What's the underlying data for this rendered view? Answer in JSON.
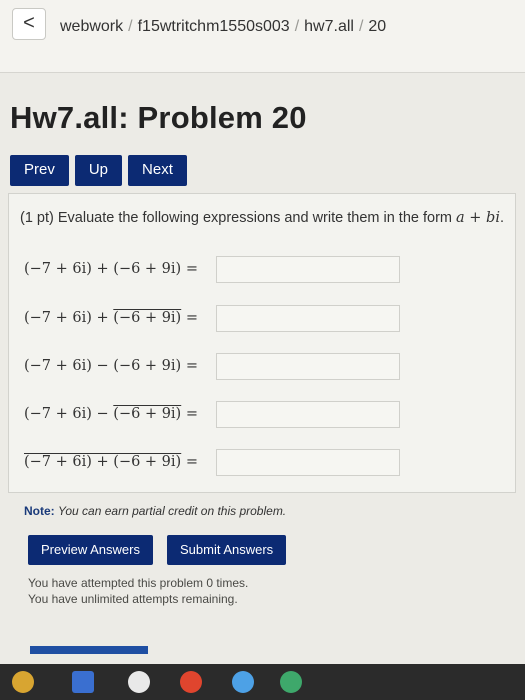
{
  "header": {
    "back_glyph": "<",
    "breadcrumb": [
      "webwork",
      "f15wtritchm1550s003",
      "hw7.all",
      "20"
    ],
    "separator": "/"
  },
  "page_title": "Hw7.all: Problem 20",
  "nav": {
    "prev": "Prev",
    "up": "Up",
    "next": "Next"
  },
  "problem": {
    "points": "(1 pt)",
    "prompt": "Evaluate the following expressions and write them in the form",
    "form": "a + bi",
    "rows": [
      {
        "left": "(−7 + 6i) + (−6 + 9i) =",
        "answer": ""
      },
      {
        "left_a": "(−7 + 6i) + ",
        "left_bar": "(−6 + 9i)",
        "left_b": " =",
        "answer": ""
      },
      {
        "left": "(−7 + 6i) − (−6 + 9i) =",
        "answer": ""
      },
      {
        "left_a": "(−7 + 6i) − ",
        "left_bar": "(−6 + 9i)",
        "left_b": " =",
        "answer": ""
      },
      {
        "left_bar": "(−7 + 6i) + (−6 + 9i)",
        "left_b": " =",
        "answer": ""
      }
    ]
  },
  "note": {
    "label": "Note:",
    "text": "You can earn partial credit on this problem."
  },
  "actions": {
    "preview": "Preview Answers",
    "submit": "Submit Answers"
  },
  "status": {
    "attempts": "You have attempted this problem 0 times.",
    "remaining": "You have unlimited attempts remaining."
  },
  "colors": {
    "button_bg": "#0c2a73",
    "panel_bg": "#f3f3ef"
  }
}
